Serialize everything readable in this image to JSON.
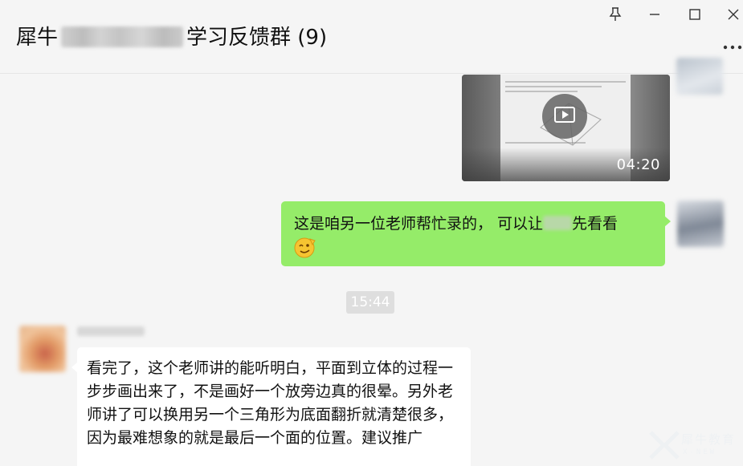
{
  "window": {
    "title_prefix": "犀牛",
    "title_suffix": "学习反馈群 (9)"
  },
  "icons": {
    "pin": "pin-icon",
    "minimize": "minimize-icon",
    "maximize": "maximize-icon",
    "close": "close-icon",
    "more": "more-icon",
    "play": "play-icon",
    "emoji": "emoji-face-icon",
    "watermark": "brand-logo"
  },
  "messages": [
    {
      "type": "video",
      "side": "right",
      "duration": "04:20"
    },
    {
      "type": "text",
      "side": "right",
      "text_before": "这是咱另一位老师帮忙录的， 可以让",
      "text_after": "先看看"
    },
    {
      "type": "timestamp",
      "text": "15:44"
    },
    {
      "type": "text",
      "side": "left",
      "text": "看完了，这个老师讲的能听明白，平面到立体的过程一步步画出来了，不是画好一个放旁边真的很晕。另外老师讲了可以换用另一个三角形为底面翻折就清楚很多，因为最难想象的就是最后一个面的位置。建议推广"
    }
  ],
  "watermark": {
    "brand": "犀牛教育",
    "sub": "X-NEW"
  },
  "colors": {
    "background": "#f5f5f5",
    "self_bubble": "#95ec69",
    "other_bubble": "#ffffff",
    "timestamp_bg": "#dedede"
  }
}
